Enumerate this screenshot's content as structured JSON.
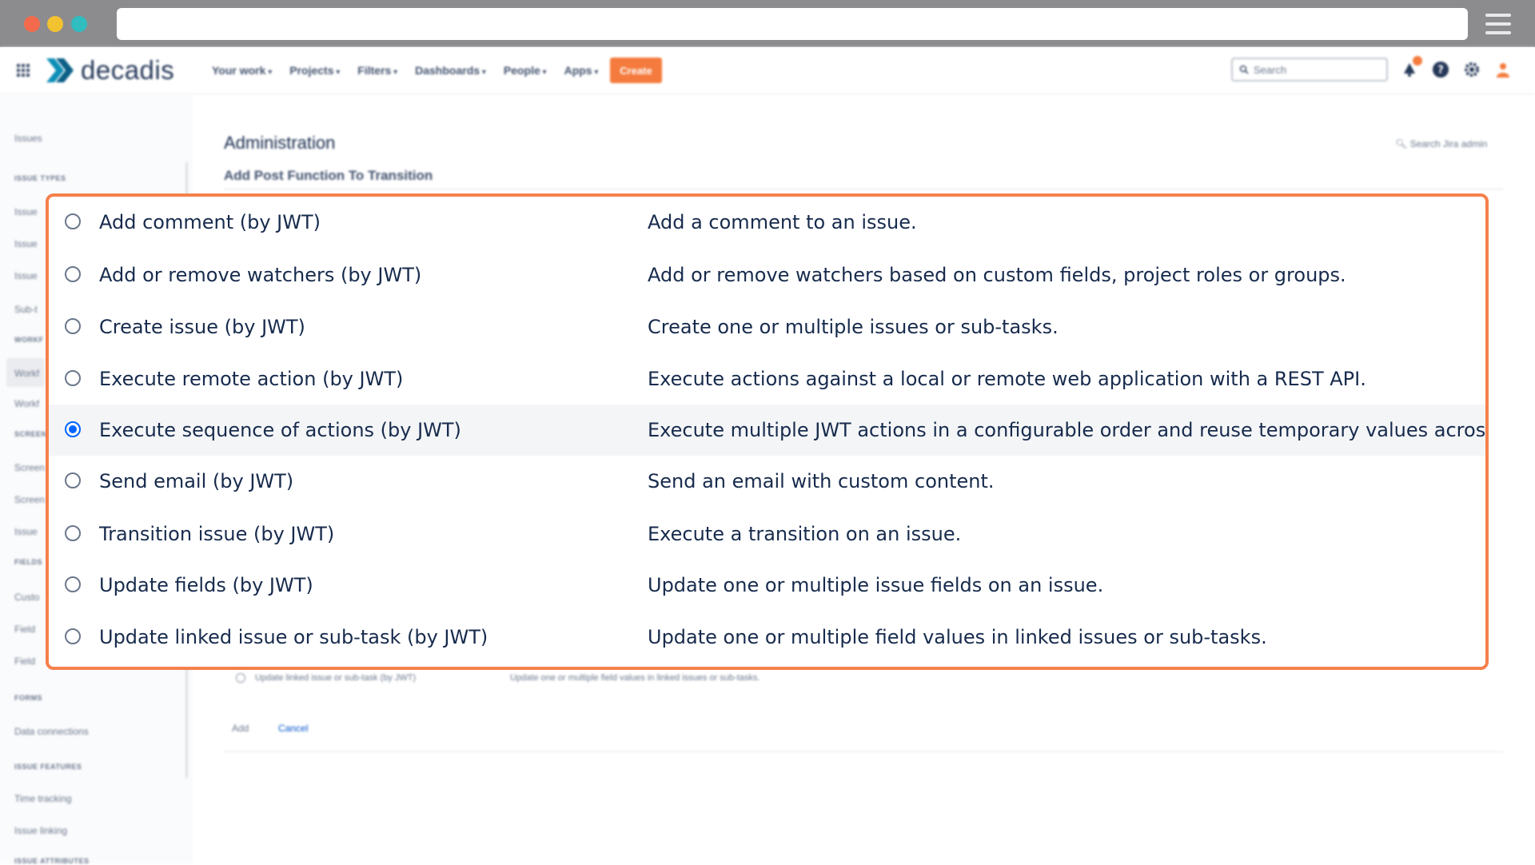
{
  "header": {
    "logo_text": "decadis",
    "nav": [
      "Your work",
      "Projects",
      "Filters",
      "Dashboards",
      "People",
      "Apps"
    ],
    "create_label": "Create",
    "search_placeholder": "Search"
  },
  "sidebar": {
    "items": [
      {
        "type": "item",
        "label": "Issues"
      },
      {
        "type": "head",
        "label": "ISSUE TYPES"
      },
      {
        "type": "item",
        "label": "Issue"
      },
      {
        "type": "item",
        "label": "Issue"
      },
      {
        "type": "item",
        "label": "Issue"
      },
      {
        "type": "item",
        "label": "Sub-t"
      },
      {
        "type": "head",
        "label": "WORKF"
      },
      {
        "type": "item",
        "label": "Workf"
      },
      {
        "type": "item",
        "label": "Workf"
      },
      {
        "type": "head",
        "label": "SCREEN"
      },
      {
        "type": "item",
        "label": "Screen"
      },
      {
        "type": "item",
        "label": "Screen"
      },
      {
        "type": "item",
        "label": "Issue"
      },
      {
        "type": "head",
        "label": "FIELDS"
      },
      {
        "type": "item",
        "label": "Custo"
      },
      {
        "type": "item",
        "label": "Field"
      },
      {
        "type": "item",
        "label": "Field"
      },
      {
        "type": "head",
        "label": "FORMS"
      },
      {
        "type": "item",
        "label": "Data connections"
      },
      {
        "type": "head",
        "label": "ISSUE FEATURES"
      },
      {
        "type": "item",
        "label": "Time tracking"
      },
      {
        "type": "item",
        "label": "Issue linking"
      },
      {
        "type": "head",
        "label": "ISSUE ATTRIBUTES"
      }
    ]
  },
  "admin": {
    "title": "Administration",
    "subtitle": "Add Post Function To Transition",
    "search_label": "Search Jira admin",
    "ghost_label": "Update linked issue or sub-task (by JWT)",
    "ghost_desc": "Update one or multiple field values in linked issues or sub-tasks.",
    "add_label": "Add",
    "cancel_label": "Cancel"
  },
  "options": [
    {
      "label": "Add comment (by JWT)",
      "description": "Add a comment to an issue.",
      "selected": false
    },
    {
      "label": "Add or remove watchers (by JWT)",
      "description": "Add or remove watchers based on custom fields, project roles or groups.",
      "selected": false
    },
    {
      "label": "Create issue (by JWT)",
      "description": "Create one or multiple issues or sub-tasks.",
      "selected": false
    },
    {
      "label": "Execute remote action (by JWT)",
      "description": "Execute actions against a local or remote web application with a REST API.",
      "selected": false
    },
    {
      "label": "Execute sequence of actions (by JWT)",
      "description": "Execute multiple JWT actions in a configurable order and reuse temporary values across actions.",
      "selected": true
    },
    {
      "label": "Send email (by JWT)",
      "description": "Send an email with custom content.",
      "selected": false
    },
    {
      "label": "Transition issue (by JWT)",
      "description": "Execute a transition on an issue.",
      "selected": false
    },
    {
      "label": "Update fields (by JWT)",
      "description": "Update one or multiple issue fields on an issue.",
      "selected": false
    },
    {
      "label": "Update linked issue or sub-task (by JWT)",
      "description": "Update one or multiple field values in linked issues or sub-tasks.",
      "selected": false
    }
  ],
  "colors": {
    "highlight_border": "#f5804b",
    "radio_selected": "#0065ff",
    "create_button": "#f47b3d"
  }
}
